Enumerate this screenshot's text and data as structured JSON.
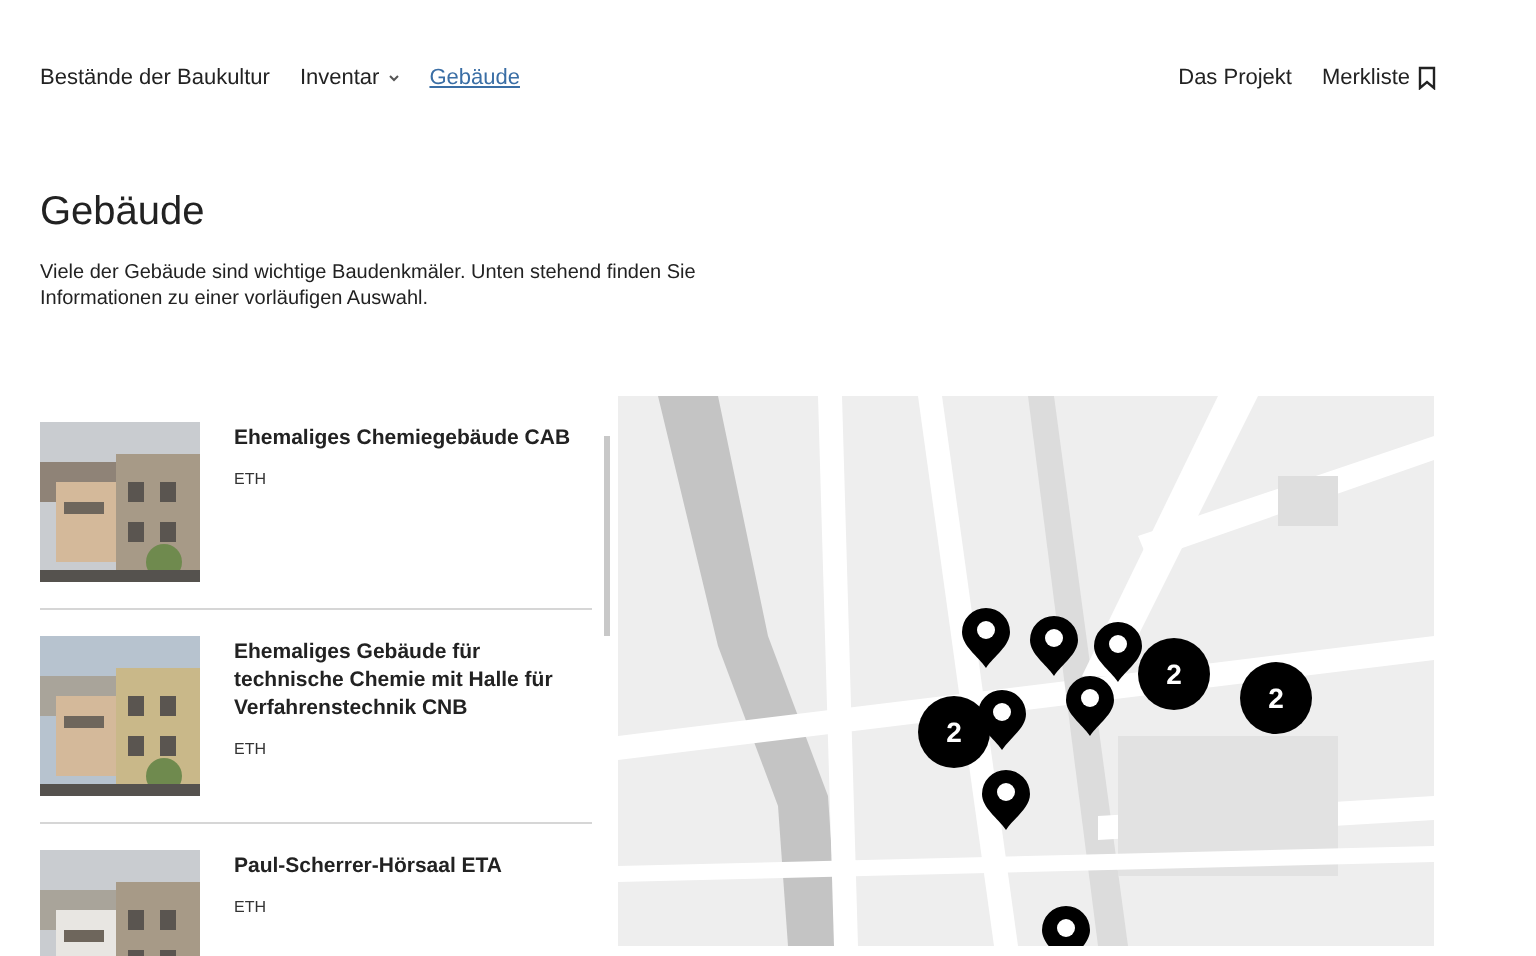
{
  "nav": {
    "left": [
      {
        "label": "Bestände der Baukultur",
        "kind": "link",
        "selected": false
      },
      {
        "label": "Inventar",
        "kind": "dropdown",
        "selected": false
      },
      {
        "label": "Gebäude",
        "kind": "link",
        "selected": true
      }
    ],
    "right": [
      {
        "label": "Das Projekt",
        "kind": "link"
      },
      {
        "label": "Merkliste",
        "kind": "bookmark"
      }
    ]
  },
  "page": {
    "title": "Gebäude",
    "intro": "Viele der Gebäude sind wichtige Baudenkmäler. Unten stehend finden Sie Informationen zu einer vorläufigen Auswahl."
  },
  "buildings": [
    {
      "name": "Ehemaliges Chemiegebäude CAB",
      "owner": "ETH",
      "kind": "picture"
    },
    {
      "name": "Ehemaliges Gebäude für technische Chemie mit Halle für Verfahrenstechnik CNB",
      "owner": "ETH",
      "kind": "picture"
    },
    {
      "name": "Paul-Scherrer-Hörsaal ETA",
      "owner": "ETH",
      "kind": "picture"
    }
  ],
  "map": {
    "kind": "picture",
    "markers": [
      {
        "kind": "pin"
      },
      {
        "kind": "pin"
      },
      {
        "kind": "pin"
      },
      {
        "kind": "cluster",
        "count": "2"
      },
      {
        "kind": "cluster",
        "count": "2"
      },
      {
        "kind": "pin"
      },
      {
        "kind": "cluster",
        "count": "2"
      },
      {
        "kind": "pin"
      },
      {
        "kind": "pin"
      },
      {
        "kind": "pin"
      }
    ]
  }
}
